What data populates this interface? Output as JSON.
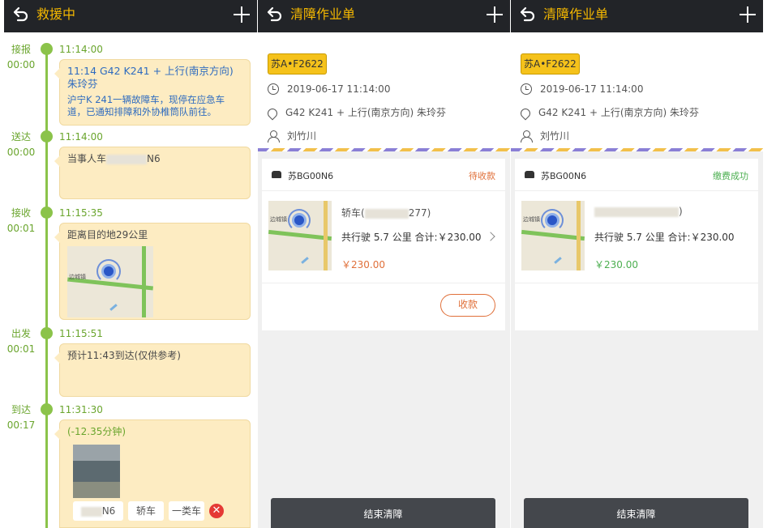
{
  "screen1": {
    "title": "救援中",
    "timeline": [
      {
        "label": "接报",
        "duration": "00:00",
        "time": "11:14:00",
        "line1": "11:14 G42   K241 +   上行(南京方向) 朱玲芬",
        "line2": "沪宁K 241一辆故障车，现停在应急车道，已通知排障和外协椎筒队前往。"
      },
      {
        "label": "送达",
        "duration": "00:00",
        "time": "11:14:00",
        "text_prefix": "当事人车",
        "text_suffix": "N6"
      },
      {
        "label": "接收",
        "duration": "00:01",
        "time": "11:15:35",
        "text": "距离目的地29公里",
        "map_label": "边城镇"
      },
      {
        "label": "出发",
        "duration": "00:01",
        "time": "11:15:51",
        "text": "预计11:43到达(仅供参考)"
      },
      {
        "label": "到达",
        "duration": "00:17",
        "time": "11:31:30",
        "text": "(-12.35分钟)",
        "tags": [
          "N6",
          "轿车",
          "一类车"
        ]
      }
    ]
  },
  "screen2": {
    "title": "清障作业单",
    "plate": "苏A•F2622",
    "datetime": "2019-06-17 11:14:00",
    "location": "G42 K241 + 上行(南京方向) 朱玲芬",
    "person": "刘竹川",
    "order": {
      "plate": "苏BG00N6",
      "status": "待收款",
      "vehicle_prefix": "轿车(",
      "vehicle_suffix": "277)",
      "summary": "共行驶 5.7 公里 合计:￥230.00",
      "price": "￥230.00",
      "collect_button": "收款",
      "map_label": "边城镇"
    },
    "end_button": "结束清障"
  },
  "screen3": {
    "title": "清障作业单",
    "plate": "苏A•F2622",
    "datetime": "2019-06-17 11:14:00",
    "location": "G42 K241 + 上行(南京方向) 朱玲芬",
    "person": "刘竹川",
    "order": {
      "plate": "苏BG00N6",
      "status": "缴费成功",
      "vehicle_suffix": ")",
      "summary": "共行驶 5.7 公里 合计:￥230.00",
      "price": "￥230.00",
      "map_label": "边城镇"
    },
    "end_button": "结束清障"
  },
  "colors": {
    "accent": "#f5b800",
    "timeline": "#8bc34a",
    "pending": "#e0703a",
    "paid": "#4caf50",
    "price_pending": "#e0703a",
    "price_paid": "#4caf50"
  }
}
